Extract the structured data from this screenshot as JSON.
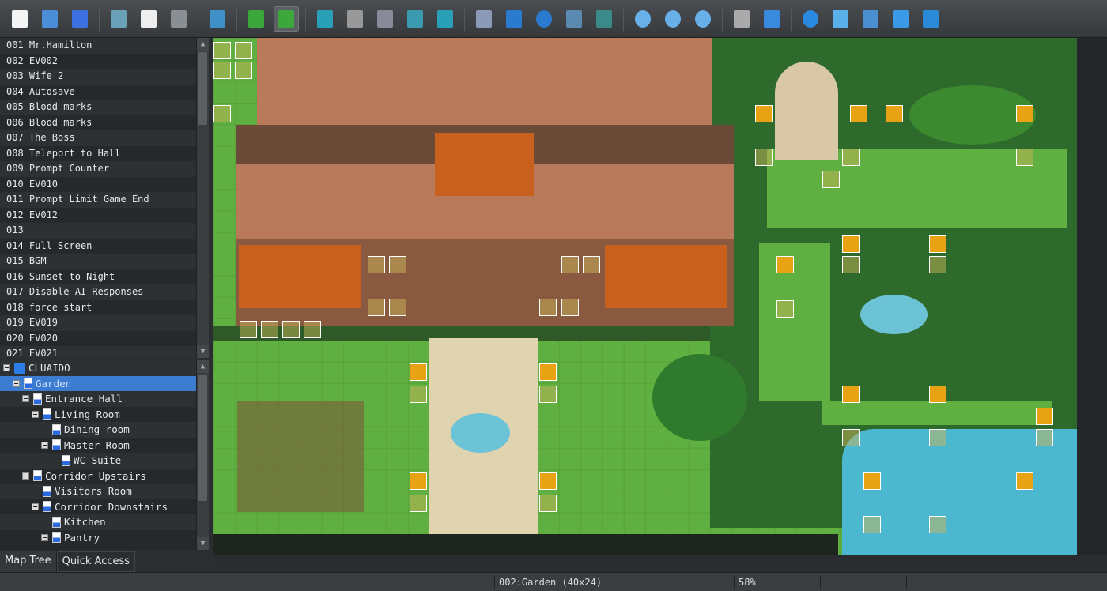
{
  "toolbar": {
    "icons": [
      "new-project-icon",
      "open-project-icon",
      "save-project-icon",
      "cut-icon",
      "copy-icon",
      "paste-icon",
      "undo-icon",
      "map-mode-icon",
      "event-mode-icon",
      "layer-auto-icon",
      "layer-1-icon",
      "layer-2-icon",
      "layer-3-icon",
      "layer-4-icon",
      "pencil-icon",
      "rectangle-icon",
      "ellipse-icon",
      "flood-fill-icon",
      "shadow-pen-icon",
      "zoom-in-icon",
      "zoom-out-icon",
      "zoom-actual-icon",
      "database-icon",
      "plugin-manager-icon",
      "sound-test-icon",
      "event-searcher-icon",
      "resource-manager-icon",
      "character-generator-icon",
      "playtest-icon"
    ]
  },
  "events": [
    "001 Mr.Hamilton",
    "002 EV002",
    "003 Wife 2",
    "004 Autosave",
    "005 Blood marks",
    "006 Blood marks",
    "007 The Boss",
    "008 Teleport to Hall",
    "009 Prompt Counter",
    "010 EV010",
    "011 Prompt Limit Game End",
    "012 EV012",
    "013",
    "014 Full Screen",
    "015 BGM",
    "016 Sunset to Night",
    "017 Disable AI Responses",
    "018 force start",
    "019 EV019",
    "020 EV020",
    "021 EV021"
  ],
  "tree": {
    "project": "CLUAIDO",
    "maps": [
      {
        "name": "Garden",
        "depth": 1,
        "toggle": true,
        "selected": true
      },
      {
        "name": "Entrance Hall",
        "depth": 2,
        "toggle": true
      },
      {
        "name": "Living Room",
        "depth": 3,
        "toggle": true
      },
      {
        "name": "Dining room",
        "depth": 4,
        "toggle": false
      },
      {
        "name": "Master Room",
        "depth": 4,
        "toggle": true
      },
      {
        "name": "WC Suite",
        "depth": 5,
        "toggle": false
      },
      {
        "name": "Corridor Upstairs",
        "depth": 2,
        "toggle": true
      },
      {
        "name": "Visitors Room",
        "depth": 3,
        "toggle": false
      },
      {
        "name": "Corridor Downstairs",
        "depth": 3,
        "toggle": true
      },
      {
        "name": "Kitchen",
        "depth": 4,
        "toggle": false
      },
      {
        "name": "Pantry",
        "depth": 4,
        "toggle": true
      }
    ]
  },
  "tabs": {
    "map_tree": "Map Tree",
    "quick_access": "Quick Access"
  },
  "status": {
    "map": "002:Garden (40x24)",
    "zoom": "58%"
  },
  "colors": {
    "selection": "#3b7bd0",
    "grass": "#5fb040",
    "hedge": "#2e6a2c",
    "roof": "#b97a5c",
    "water": "#4cb8d0"
  }
}
